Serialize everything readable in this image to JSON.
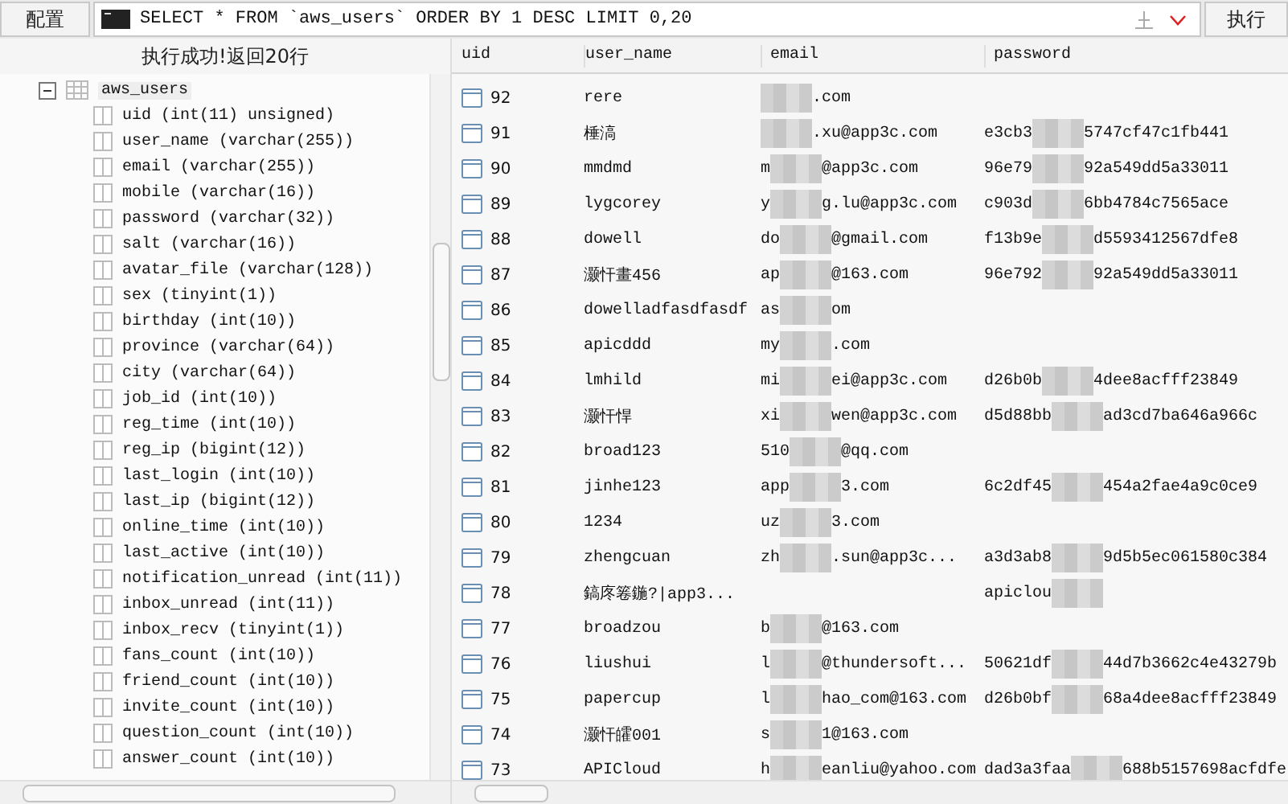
{
  "toolbar": {
    "config_button": "配置",
    "query": "SELECT * FROM `aws_users` ORDER BY 1 DESC LIMIT 0,20",
    "run_button": "执行"
  },
  "status": "执行成功!返回20行",
  "tree": {
    "table": "aws_users",
    "selected": true,
    "expanded": true,
    "children": [
      {
        "label": "uid (int(11) unsigned)"
      },
      {
        "label": "user_name (varchar(255))"
      },
      {
        "label": "email (varchar(255))"
      },
      {
        "label": "mobile (varchar(16))"
      },
      {
        "label": "password (varchar(32))"
      },
      {
        "label": "salt (varchar(16))"
      },
      {
        "label": "avatar_file (varchar(128))"
      },
      {
        "label": "sex (tinyint(1))"
      },
      {
        "label": "birthday (int(10))"
      },
      {
        "label": "province (varchar(64))"
      },
      {
        "label": "city (varchar(64))"
      },
      {
        "label": "job_id (int(10))"
      },
      {
        "label": "reg_time (int(10))"
      },
      {
        "label": "reg_ip (bigint(12))"
      },
      {
        "label": "last_login (int(10))"
      },
      {
        "label": "last_ip (bigint(12))"
      },
      {
        "label": "online_time (int(10))"
      },
      {
        "label": "last_active (int(10))"
      },
      {
        "label": "notification_unread (int(11))"
      },
      {
        "label": "inbox_unread (int(11))"
      },
      {
        "label": "inbox_recv (tinyint(1))"
      },
      {
        "label": "fans_count (int(10))"
      },
      {
        "label": "friend_count (int(10))"
      },
      {
        "label": "invite_count (int(10))"
      },
      {
        "label": "question_count (int(10))"
      },
      {
        "label": "answer_count (int(10))"
      }
    ]
  },
  "results": {
    "columns": [
      "uid",
      "user_name",
      "email",
      "password"
    ],
    "rows": [
      {
        "uid": "92",
        "user_name": "rere",
        "email": {
          "tail": ".com"
        }
      },
      {
        "uid": "91",
        "user_name": "棰滈",
        "email": {
          "tail": ".xu@app3c.com"
        },
        "password": {
          "head": "e3cb3",
          "tail": "5747cf47c1fb441"
        }
      },
      {
        "uid": "90",
        "user_name": "mmdmd",
        "email": {
          "head": "m",
          "tail": "@app3c.com"
        },
        "password": {
          "head": "96e79",
          "tail": "92a549dd5a33011"
        }
      },
      {
        "uid": "89",
        "user_name": "lygcorey",
        "email": {
          "head": "y",
          "tail": "g.lu@app3c.com"
        },
        "password": {
          "head": "c903d",
          "tail": "6bb4784c7565ace"
        }
      },
      {
        "uid": "88",
        "user_name": "dowell",
        "email": {
          "head": "do",
          "tail": "@gmail.com"
        },
        "password": {
          "head": "f13b9e",
          "tail": "d5593412567dfe8"
        }
      },
      {
        "uid": "87",
        "user_name": "灏忓畫456",
        "email": {
          "head": "ap",
          "tail": "@163.com"
        },
        "password": {
          "head": "96e792",
          "tail": "92a549dd5a33011"
        }
      },
      {
        "uid": "86",
        "user_name": "dowelladfasdfasdf",
        "email": {
          "head": "as",
          "tail": "om"
        }
      },
      {
        "uid": "85",
        "user_name": "apicddd",
        "email": {
          "head": "my",
          "tail": ".com"
        }
      },
      {
        "uid": "84",
        "user_name": "lmhild",
        "email": {
          "head": "mi",
          "tail": "ei@app3c.com"
        },
        "password": {
          "head": "d26b0b",
          "tail": "4dee8acfff23849"
        }
      },
      {
        "uid": "83",
        "user_name": "灏忓悍",
        "email": {
          "head": "xi",
          "tail": "wen@app3c.com"
        },
        "password": {
          "head": "d5d88bb",
          "tail": "ad3cd7ba646a966c"
        }
      },
      {
        "uid": "82",
        "user_name": "broad123",
        "email": {
          "head": "510",
          "tail": "@qq.com"
        }
      },
      {
        "uid": "81",
        "user_name": "jinhe123",
        "email": {
          "head": "app",
          "tail": "3.com"
        },
        "password": {
          "head": "6c2df45",
          "tail": "454a2fae4a9c0ce9"
        }
      },
      {
        "uid": "80",
        "user_name": "1234",
        "email": {
          "head": "uz",
          "tail": "3.com"
        }
      },
      {
        "uid": "79",
        "user_name": "zhengcuan",
        "email": {
          "head": "zh",
          "tail": ".sun@app3c..."
        },
        "password": {
          "head": "a3d3ab8",
          "tail": "9d5b5ec061580c384"
        }
      },
      {
        "uid": "78",
        "user_name": "鎬庝箞鍦?|app3...",
        "password": {
          "head": "apiclou"
        }
      },
      {
        "uid": "77",
        "user_name": "broadzou",
        "email": {
          "head": "b",
          "tail": "@163.com"
        }
      },
      {
        "uid": "76",
        "user_name": "liushui",
        "email": {
          "head": "l",
          "tail": "@thundersoft..."
        },
        "password": {
          "head": "50621df",
          "tail": "44d7b3662c4e43279b"
        }
      },
      {
        "uid": "75",
        "user_name": "papercup",
        "email": {
          "head": "l",
          "tail": "hao_com@163.com"
        },
        "password": {
          "head": "d26b0bf",
          "tail": "68a4dee8acfff23849"
        }
      },
      {
        "uid": "74",
        "user_name": "灏忓皬001",
        "email": {
          "head": "s",
          "tail": "1@163.com"
        }
      },
      {
        "uid": "73",
        "user_name": "APICloud",
        "email": {
          "head": "h",
          "tail": "eanliu@yahoo.com"
        },
        "password": {
          "head": "dad3a3faa",
          "tail": "688b5157698acfdfe"
        }
      }
    ]
  }
}
